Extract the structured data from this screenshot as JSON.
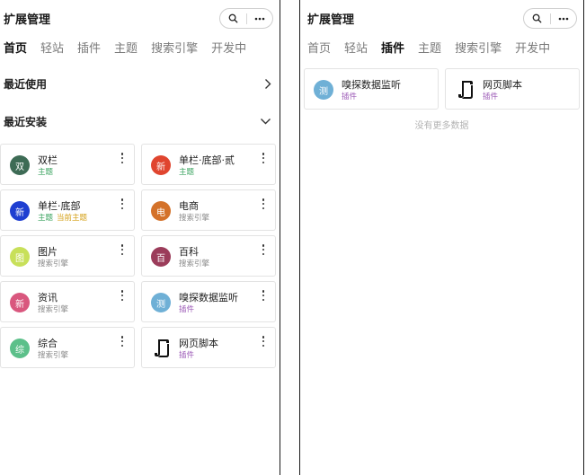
{
  "colors": {
    "theme_tag": "#3aa35f",
    "search_tag": "#8a8a8a",
    "plugin_tag": "#9b59b6",
    "current_theme": "#d4a017"
  },
  "left": {
    "header": {
      "title": "扩展管理",
      "search_icon": "search-icon",
      "more_icon": "more-horizontal-icon"
    },
    "tabs": [
      {
        "label": "首页",
        "active": true
      },
      {
        "label": "轻站",
        "active": false
      },
      {
        "label": "插件",
        "active": false
      },
      {
        "label": "主题",
        "active": false
      },
      {
        "label": "搜索引擎",
        "active": false
      },
      {
        "label": "开发中",
        "active": false
      }
    ],
    "recent_used": {
      "label": "最近使用",
      "icon": "chevron-right-icon"
    },
    "recent_installed": {
      "label": "最近安装",
      "icon": "chevron-down-icon"
    },
    "cards": [
      {
        "avatar": "双",
        "avatar_color": "#3d6b55",
        "name": "双栏",
        "tag": "主题",
        "tag_color": "#3aa35f",
        "extra": ""
      },
      {
        "avatar": "新",
        "avatar_color": "#e0452f",
        "name": "单栏·底部·贰",
        "tag": "主题",
        "tag_color": "#3aa35f",
        "extra": ""
      },
      {
        "avatar": "新",
        "avatar_color": "#1f3fd1",
        "name": "单栏·底部",
        "tag": "主题",
        "tag_color": "#3aa35f",
        "extra": "当前主题"
      },
      {
        "avatar": "电",
        "avatar_color": "#d4722a",
        "name": "电商",
        "tag": "搜索引擎",
        "tag_color": "#8a8a8a",
        "extra": ""
      },
      {
        "avatar": "图",
        "avatar_color": "#c8e05a",
        "name": "图片",
        "tag": "搜索引擎",
        "tag_color": "#8a8a8a",
        "extra": ""
      },
      {
        "avatar": "百",
        "avatar_color": "#9b3c5a",
        "name": "百科",
        "tag": "搜索引擎",
        "tag_color": "#8a8a8a",
        "extra": ""
      },
      {
        "avatar": "新",
        "avatar_color": "#d9577e",
        "name": "资讯",
        "tag": "搜索引擎",
        "tag_color": "#8a8a8a",
        "extra": ""
      },
      {
        "avatar": "测",
        "avatar_color": "#6fb0d6",
        "name": "嗅探数据监听",
        "tag": "插件",
        "tag_color": "#9b59b6",
        "extra": ""
      },
      {
        "avatar": "综",
        "avatar_color": "#5cc08a",
        "name": "综合",
        "tag": "搜索引擎",
        "tag_color": "#8a8a8a",
        "extra": ""
      },
      {
        "avatar": "",
        "avatar_color": "",
        "name": "网页脚本",
        "tag": "插件",
        "tag_color": "#9b59b6",
        "extra": "",
        "icon": "script-scroll-icon"
      }
    ]
  },
  "right": {
    "header": {
      "title": "扩展管理",
      "search_icon": "search-icon",
      "more_icon": "more-horizontal-icon"
    },
    "tabs": [
      {
        "label": "首页",
        "active": false
      },
      {
        "label": "轻站",
        "active": false
      },
      {
        "label": "插件",
        "active": true
      },
      {
        "label": "主题",
        "active": false
      },
      {
        "label": "搜索引擎",
        "active": false
      },
      {
        "label": "开发中",
        "active": false
      }
    ],
    "cards": [
      {
        "avatar": "测",
        "avatar_color": "#6fb0d6",
        "name": "嗅探数据监听",
        "tag": "插件",
        "tag_color": "#9b59b6"
      },
      {
        "avatar": "",
        "avatar_color": "",
        "name": "网页脚本",
        "tag": "插件",
        "tag_color": "#9b59b6",
        "icon": "script-scroll-icon"
      }
    ],
    "empty_text": "没有更多数据"
  }
}
